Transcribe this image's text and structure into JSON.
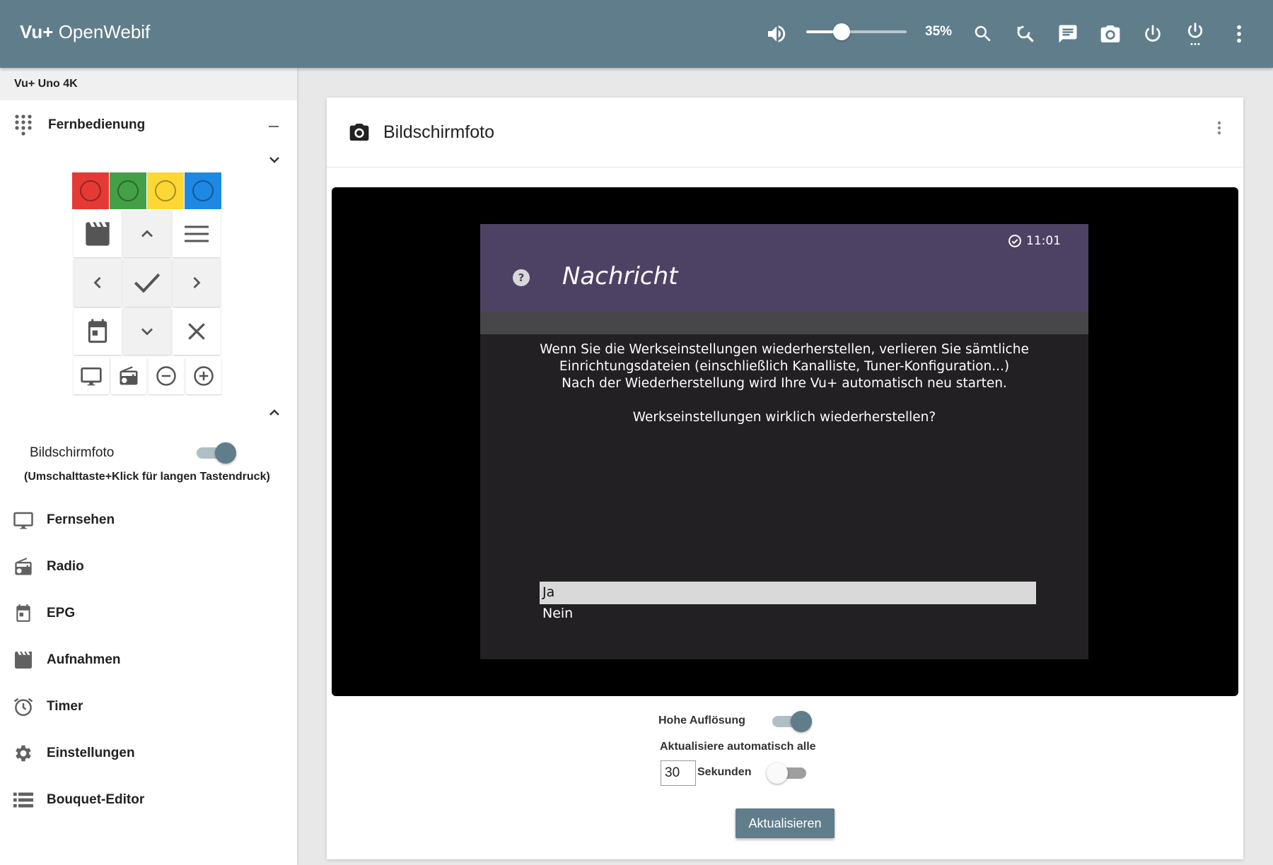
{
  "header": {
    "brand_bold": "Vu+",
    "brand_rest": "OpenWebif",
    "volume_percent": 35,
    "volume_label": "35%",
    "icons": [
      "volume-icon",
      "search-icon",
      "zoom-refresh-icon",
      "message-icon",
      "camera-icon",
      "power-icon",
      "standby-icon",
      "more-vert-icon"
    ]
  },
  "sidebar": {
    "device_name": "Vu+ Uno 4K",
    "remote_section_label": "Fernbedienung",
    "color_buttons": [
      "#e53935",
      "#43a047",
      "#fdd835",
      "#1e88e5"
    ],
    "screenshot_label": "Bildschirmfoto",
    "screenshot_toggle_on": true,
    "hint": "(Umschalttaste+Klick für langen Tastendruck)",
    "nav": [
      {
        "label": "Fernsehen",
        "icon": "tv-icon"
      },
      {
        "label": "Radio",
        "icon": "radio-icon"
      },
      {
        "label": "EPG",
        "icon": "calendar-icon"
      },
      {
        "label": "Aufnahmen",
        "icon": "movie-icon"
      },
      {
        "label": "Timer",
        "icon": "alarm-icon"
      },
      {
        "label": "Einstellungen",
        "icon": "gear-icon"
      },
      {
        "label": "Bouquet-Editor",
        "icon": "list-icon"
      }
    ]
  },
  "main": {
    "title": "Bildschirmfoto",
    "tv": {
      "clock": "11:01",
      "title": "Nachricht",
      "line1": "Wenn Sie die Werkseinstellungen wiederherstellen, verlieren Sie sämtliche",
      "line2": "Einrichtungsdateien (einschließlich Kanalliste, Tuner-Konfiguration...)",
      "line3": "Nach der Wiederherstellung wird Ihre Vu+ automatisch neu starten.",
      "question": "Werkseinstellungen wirklich wiederherstellen?",
      "options": [
        "Ja",
        "Nein"
      ],
      "selected_option": "Ja"
    },
    "high_res_label": "Hohe Auflösung",
    "high_res_on": true,
    "auto_refresh_label": "Aktualisiere automatisch alle",
    "seconds_value": "30",
    "seconds_label": "Sekunden",
    "auto_refresh_on": false,
    "refresh_button": "Aktualisieren"
  }
}
